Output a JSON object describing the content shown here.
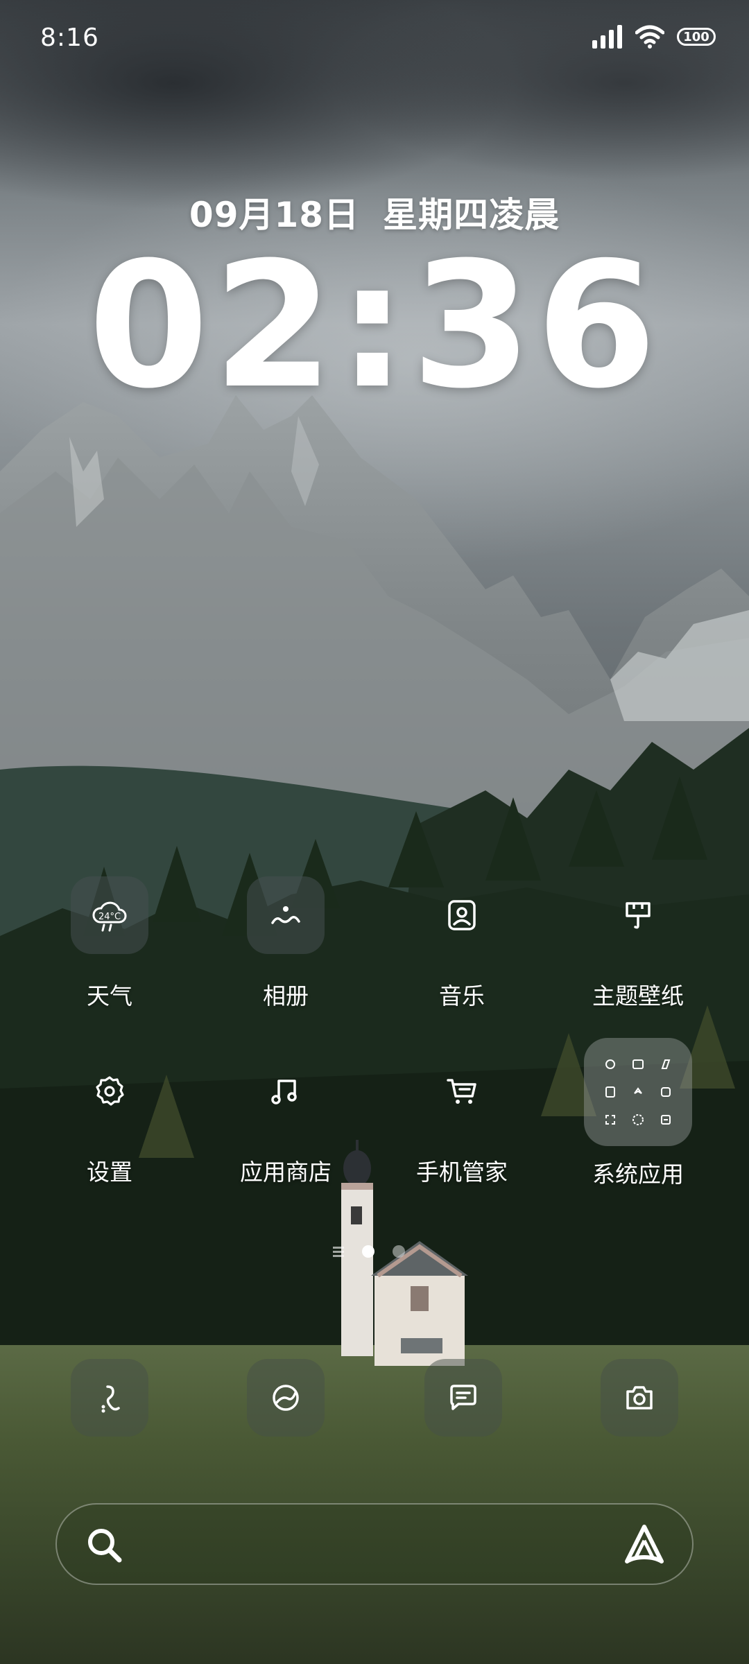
{
  "status_bar": {
    "time": "8:16",
    "battery": "100",
    "icons": [
      "signal-icon",
      "wifi-icon",
      "battery-icon"
    ]
  },
  "lockscreen": {
    "date": "09月18日",
    "weekday_period": "星期四凌晨",
    "clock": "02:36"
  },
  "apps": [
    {
      "label": "天气",
      "icon": "weather-icon",
      "detail": "24°C"
    },
    {
      "label": "相册",
      "icon": "gallery-icon"
    },
    {
      "label": "音乐",
      "icon": "music-icon"
    },
    {
      "label": "主题壁纸",
      "icon": "theme-icon"
    },
    {
      "label": "设置",
      "icon": "settings-icon"
    },
    {
      "label": "应用商店",
      "icon": "app-store-icon"
    },
    {
      "label": "手机管家",
      "icon": "security-cart-icon"
    },
    {
      "label": "系统应用",
      "icon": "folder-icon"
    }
  ],
  "page_indicator": {
    "pages": 2,
    "active": 1
  },
  "dock": [
    {
      "icon": "phone-icon"
    },
    {
      "icon": "browser-icon"
    },
    {
      "icon": "messages-icon"
    },
    {
      "icon": "camera-icon"
    }
  ],
  "search": {
    "icon": "search-icon",
    "assistant_icon": "assistant-icon"
  },
  "colors": {
    "text": "#ffffff",
    "tile": "#464e50",
    "folder": "#969c9c"
  }
}
